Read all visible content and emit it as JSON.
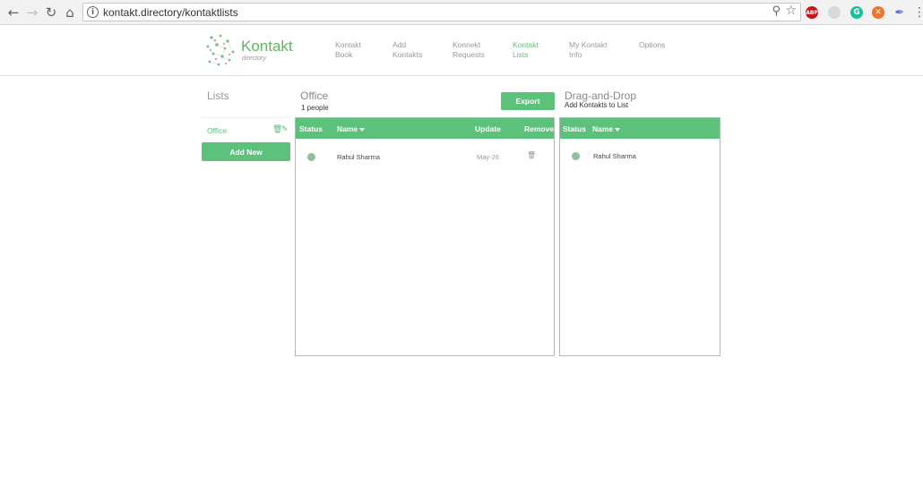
{
  "browser": {
    "url": "kontakt.directory/kontaktlists",
    "extensions": {
      "abp": "ABP",
      "grammarly": "G",
      "x_ext": "✕"
    }
  },
  "logo": {
    "word": "Kontakt",
    "sub": "directory"
  },
  "nav": [
    {
      "line1": "Kontakt",
      "line2": "Book"
    },
    {
      "line1": "Add",
      "line2": "Kontakts"
    },
    {
      "line1": "Konnekt",
      "line2": "Requests"
    },
    {
      "line1": "Kontakt",
      "line2": "Lists"
    },
    {
      "line1": "My Kontakt",
      "line2": "Info"
    },
    {
      "line1": "Options",
      "line2": ""
    }
  ],
  "lists": {
    "title": "Lists",
    "items": [
      {
        "name": "Office"
      }
    ],
    "add_new_label": "Add New"
  },
  "office": {
    "title": "Office",
    "subtitle": "1 people",
    "export_label": "Export",
    "headers": {
      "status": "Status",
      "name": "Name",
      "update": "Update",
      "remove": "Remove"
    },
    "rows": [
      {
        "name": "Rahul Sharma",
        "update": "May-26"
      }
    ]
  },
  "dnd": {
    "title": "Drag-and-Drop",
    "subtitle": "Add Kontakts to List",
    "headers": {
      "status": "Status",
      "name": "Name"
    },
    "rows": [
      {
        "name": "Rahul Sharma"
      }
    ]
  },
  "colors": {
    "accent": "#5cc17a",
    "status_dot": "#8fbf9b"
  }
}
